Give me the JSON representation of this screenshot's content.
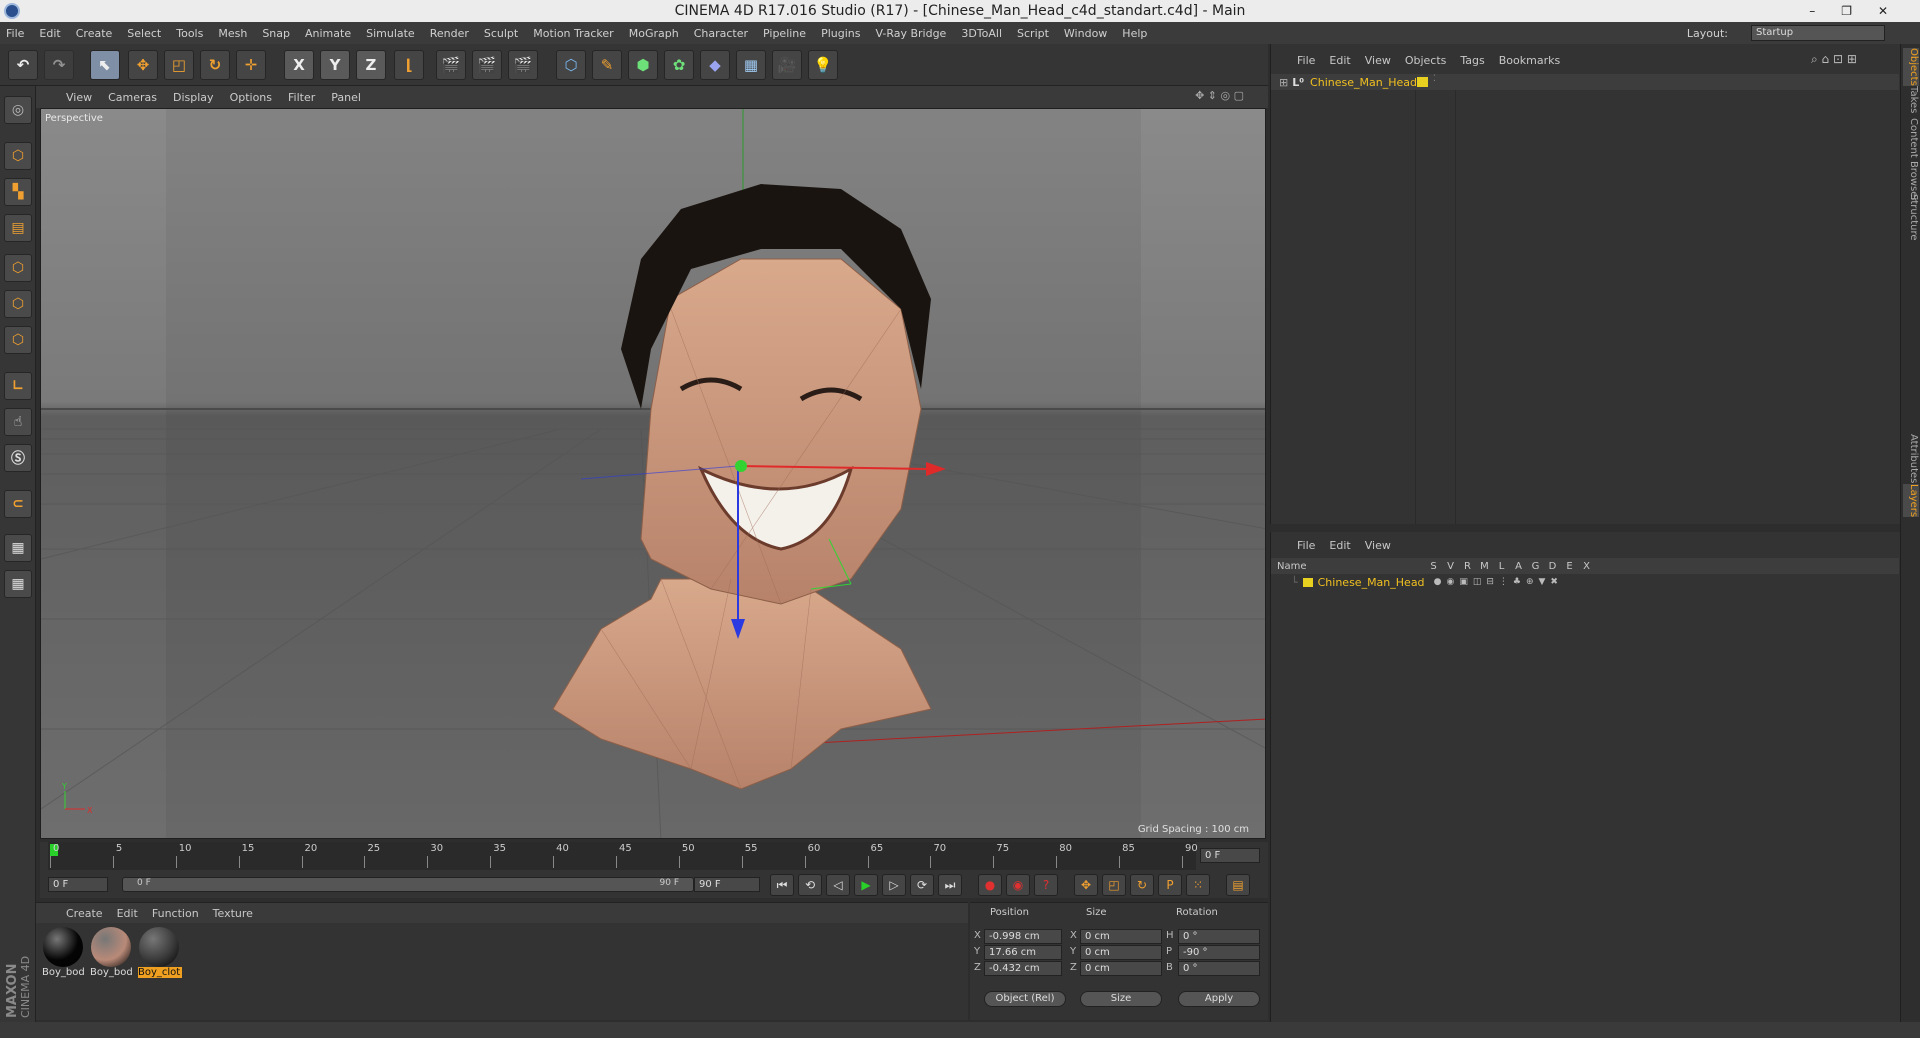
{
  "window": {
    "title": "CINEMA 4D R17.016 Studio (R17) - [Chinese_Man_Head_c4d_standart.c4d] - Main"
  },
  "menubar": {
    "items": [
      "File",
      "Edit",
      "Create",
      "Select",
      "Tools",
      "Mesh",
      "Snap",
      "Animate",
      "Simulate",
      "Render",
      "Sculpt",
      "Motion Tracker",
      "MoGraph",
      "Character",
      "Pipeline",
      "Plugins",
      "V-Ray Bridge",
      "3DToAll",
      "Script",
      "Window",
      "Help"
    ],
    "layout_label": "Layout:",
    "layout_value": "Startup"
  },
  "toolbar": {
    "axis_x": "X",
    "axis_y": "Y",
    "axis_z": "Z"
  },
  "viewport": {
    "menu": [
      "View",
      "Cameras",
      "Display",
      "Options",
      "Filter",
      "Panel"
    ],
    "label": "Perspective",
    "grid_spacing": "Grid Spacing : 100 cm"
  },
  "timeline": {
    "ticks": [
      "0",
      "5",
      "10",
      "15",
      "20",
      "25",
      "30",
      "35",
      "40",
      "45",
      "50",
      "55",
      "60",
      "65",
      "70",
      "75",
      "80",
      "85",
      "90"
    ],
    "current_frame": "0 F"
  },
  "transport": {
    "start": "0 F",
    "range_start": "0 F",
    "range_end": "90 F",
    "end": "90 F"
  },
  "materials": {
    "menu": [
      "Create",
      "Edit",
      "Function",
      "Texture"
    ],
    "items": [
      {
        "name": "Boy_bod",
        "color": "#050505"
      },
      {
        "name": "Boy_bod",
        "color": "#b98a78"
      },
      {
        "name": "Boy_clot",
        "color": "#3a3a3a"
      }
    ]
  },
  "coordinates": {
    "headers": [
      "Position",
      "Size",
      "Rotation"
    ],
    "rows": [
      {
        "axis": "X",
        "pos": "-0.998 cm",
        "size_axis": "X",
        "size": "0 cm",
        "rot_axis": "H",
        "rot": "0 °"
      },
      {
        "axis": "Y",
        "pos": "17.66 cm",
        "size_axis": "Y",
        "size": "0 cm",
        "rot_axis": "P",
        "rot": "-90 °"
      },
      {
        "axis": "Z",
        "pos": "-0.432 cm",
        "size_axis": "Z",
        "size": "0 cm",
        "rot_axis": "B",
        "rot": "0 °"
      }
    ],
    "mode": "Object (Rel)",
    "size_mode": "Size",
    "apply": "Apply"
  },
  "objects": {
    "menu": [
      "File",
      "Edit",
      "View",
      "Objects",
      "Tags",
      "Bookmarks"
    ],
    "item": "Chinese_Man_Head"
  },
  "layers": {
    "menu": [
      "File",
      "Edit",
      "View"
    ],
    "headers": [
      "Name",
      "S",
      "V",
      "R",
      "M",
      "L",
      "A",
      "G",
      "D",
      "E",
      "X"
    ],
    "item": "Chinese_Man_Head"
  },
  "sidetabs": [
    "Objects",
    "Takes",
    "Content Browser",
    "Structure",
    "Attributes",
    "Layers"
  ],
  "brand": {
    "maxon": "MAXON",
    "product": "CINEMA 4D"
  }
}
